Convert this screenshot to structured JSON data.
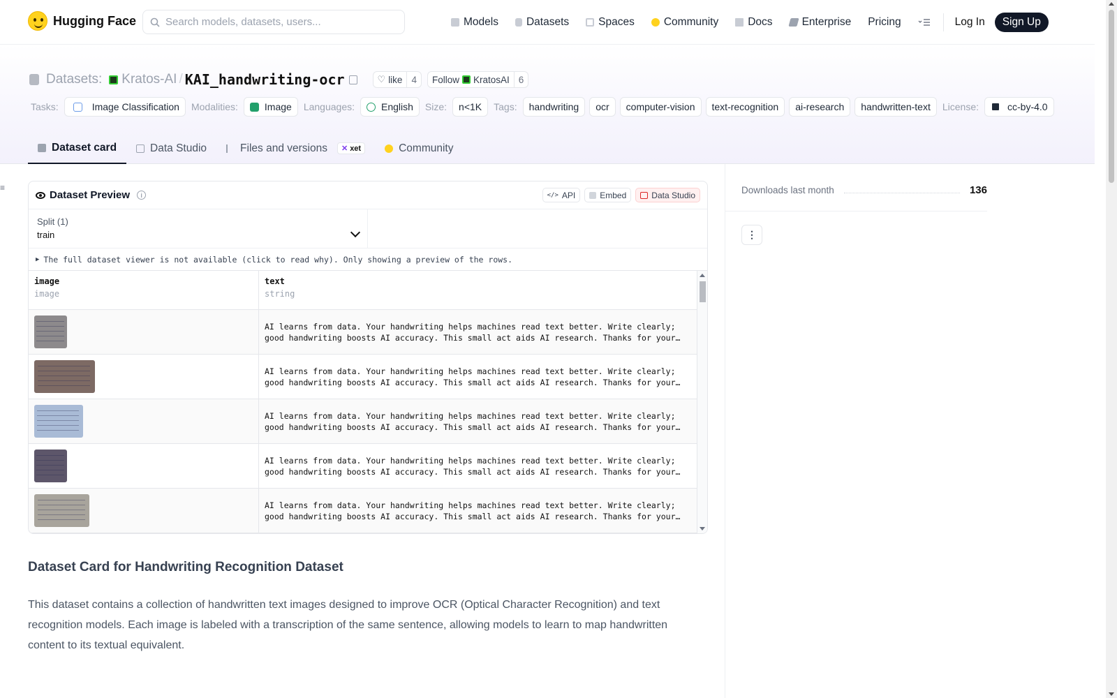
{
  "nav": {
    "brand": "Hugging Face",
    "search_placeholder": "Search models, datasets, users...",
    "links": [
      "Models",
      "Datasets",
      "Spaces",
      "Community",
      "Docs",
      "Enterprise",
      "Pricing"
    ],
    "login": "Log In",
    "signup": "Sign Up"
  },
  "repo": {
    "type_label": "Datasets:",
    "org": "Kratos-AI",
    "name": "KAI_handwriting-ocr",
    "like_label": "like",
    "like_count": "4",
    "follow_label": "Follow",
    "follow_org": "KratosAI",
    "follow_count": "6"
  },
  "tags": {
    "tasks_label": "Tasks:",
    "task": "Image Classification",
    "modalities_label": "Modalities:",
    "modality": "Image",
    "languages_label": "Languages:",
    "language": "English",
    "size_label": "Size:",
    "size": "n<1K",
    "tags_label": "Tags:",
    "tag_list": [
      "handwriting",
      "ocr",
      "computer-vision",
      "text-recognition",
      "ai-research",
      "handwritten-text"
    ],
    "license_label": "License:",
    "license": "cc-by-4.0"
  },
  "tabs": [
    "Dataset card",
    "Data Studio",
    "Files and versions",
    "Community"
  ],
  "xet_badge": "xet",
  "preview": {
    "title": "Dataset Preview",
    "api": "API",
    "embed": "Embed",
    "data_studio": "Data Studio",
    "split_label": "Split (1)",
    "split_value": "train",
    "notice": "The full dataset viewer is not available (click to read why). Only showing a preview of the rows.",
    "columns": [
      {
        "name": "image",
        "type": "image"
      },
      {
        "name": "text",
        "type": "string"
      }
    ],
    "row_text": "AI learns from data. Your handwriting helps machines read text better. Write clearly; good handwriting boosts AI accuracy. This small act aids AI research. Thanks for your contribution!",
    "thumbs": [
      {
        "color": "#8d8a8c"
      },
      {
        "color": "#7d6a64"
      },
      {
        "color": "#a9bbd6"
      },
      {
        "color": "#5d566a"
      },
      {
        "color": "#a8a49c"
      }
    ]
  },
  "card": {
    "heading": "Dataset Card for Handwriting Recognition Dataset",
    "paragraph": "This dataset contains a collection of handwritten text images designed to improve OCR (Optical Character Recognition) and text recognition models. Each image is labeled with a transcription of the same sentence, allowing models to learn to map handwritten content to its textual equivalent."
  },
  "sidebar": {
    "downloads_label": "Downloads last month",
    "downloads_value": "136"
  }
}
